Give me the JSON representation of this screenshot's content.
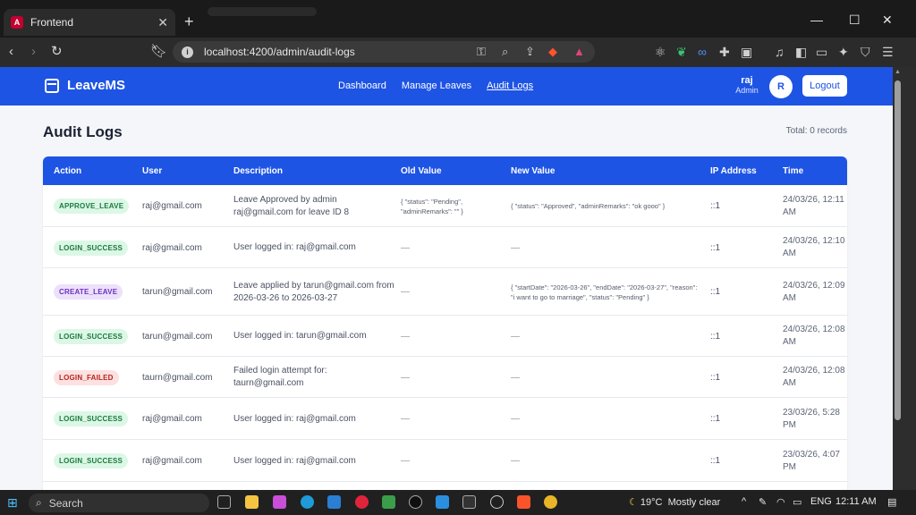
{
  "browser": {
    "tab_title": "Frontend",
    "url": "localhost:4200/admin/audit-logs"
  },
  "app": {
    "brand": "LeaveMS",
    "nav": [
      "Dashboard",
      "Manage Leaves",
      "Audit Logs"
    ],
    "user_name": "raj",
    "user_role": "Admin",
    "avatar_letter": "R",
    "logout_label": "Logout"
  },
  "page": {
    "title": "Audit Logs",
    "total": "Total: 0 records"
  },
  "table": {
    "headers": [
      "Action",
      "User",
      "Description",
      "Old Value",
      "New Value",
      "IP Address",
      "Time"
    ],
    "rows": [
      {
        "action": "APPROVE_LEAVE",
        "badge": "green",
        "user": "raj@gmail.com",
        "description": "Leave Approved by admin raj@gmail.com for leave ID 8",
        "old": "{ \"status\": \"Pending\", \"adminRemarks\": \"\" }",
        "new": "{ \"status\": \"Approved\", \"adminRemarks\": \"ok gooo\" }",
        "ip": "::1",
        "time": "24/03/26, 12:11 AM"
      },
      {
        "action": "LOGIN_SUCCESS",
        "badge": "green",
        "user": "raj@gmail.com",
        "description": "User logged in: raj@gmail.com",
        "old": "—",
        "new": "—",
        "ip": "::1",
        "time": "24/03/26, 12:10 AM"
      },
      {
        "action": "CREATE_LEAVE",
        "badge": "purple",
        "user": "tarun@gmail.com",
        "description": "Leave applied by tarun@gmail.com from 2026-03-26 to 2026-03-27",
        "old": "—",
        "new": "{ \"startDate\": \"2026-03-26\", \"endDate\": \"2026-03-27\", \"reason\": \"i want to go to marriage\", \"status\": \"Pending\" }",
        "ip": "::1",
        "time": "24/03/26, 12:09 AM"
      },
      {
        "action": "LOGIN_SUCCESS",
        "badge": "green",
        "user": "tarun@gmail.com",
        "description": "User logged in: tarun@gmail.com",
        "old": "—",
        "new": "—",
        "ip": "::1",
        "time": "24/03/26, 12:08 AM"
      },
      {
        "action": "LOGIN_FAILED",
        "badge": "red",
        "user": "taurn@gmail.com",
        "description": "Failed login attempt for: taurn@gmail.com",
        "old": "—",
        "new": "—",
        "ip": "::1",
        "time": "24/03/26, 12:08 AM"
      },
      {
        "action": "LOGIN_SUCCESS",
        "badge": "green",
        "user": "raj@gmail.com",
        "description": "User logged in: raj@gmail.com",
        "old": "—",
        "new": "—",
        "ip": "::1",
        "time": "23/03/26, 5:28 PM"
      },
      {
        "action": "LOGIN_SUCCESS",
        "badge": "green",
        "user": "raj@gmail.com",
        "description": "User logged in: raj@gmail.com",
        "old": "—",
        "new": "—",
        "ip": "::1",
        "time": "23/03/26, 4:07 PM"
      }
    ]
  },
  "taskbar": {
    "search_label": "Search",
    "temp": "19°C",
    "weather": "Mostly clear",
    "lang": "ENG",
    "clock": "12:11 AM"
  }
}
